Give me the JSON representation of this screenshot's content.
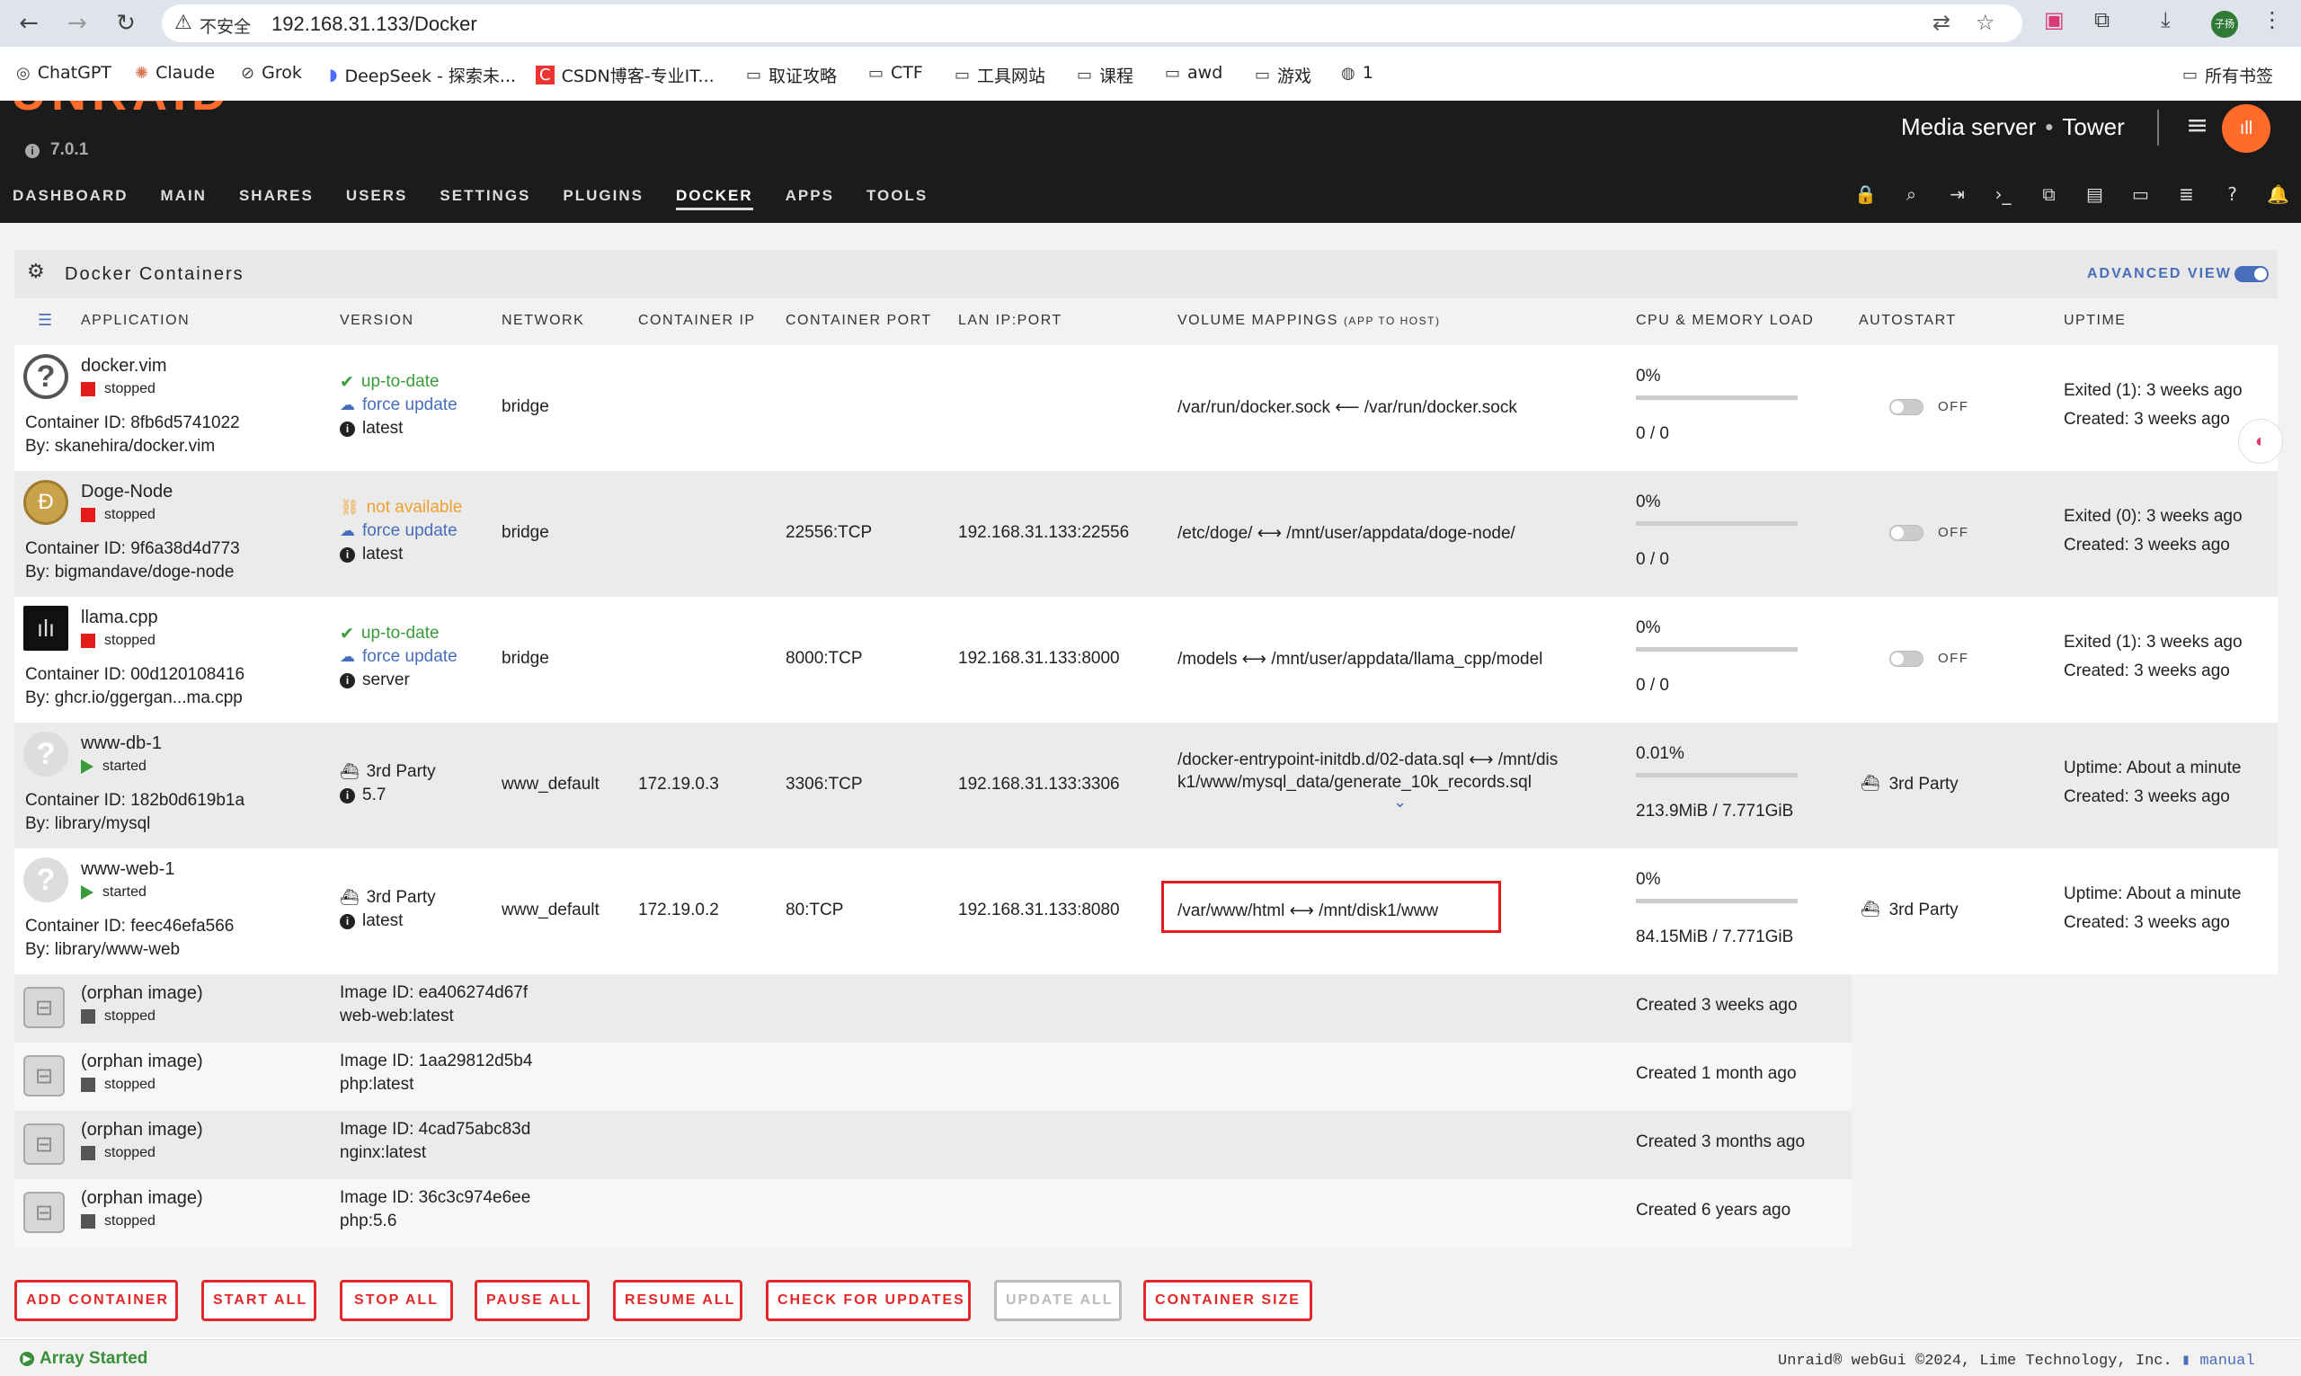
{
  "browser": {
    "insecure_label": "不安全",
    "url": "192.168.31.133/Docker",
    "bookmarks": [
      {
        "label": "ChatGPT"
      },
      {
        "label": "Claude"
      },
      {
        "label": "Grok"
      },
      {
        "label": "DeepSeek - 探索未..."
      },
      {
        "label": "CSDN博客-专业IT..."
      },
      {
        "label": "取证攻略"
      },
      {
        "label": "CTF"
      },
      {
        "label": "工具网站"
      },
      {
        "label": "课程"
      },
      {
        "label": "awd"
      },
      {
        "label": "游戏"
      },
      {
        "label": "1"
      }
    ],
    "all_bookmarks": "所有书签",
    "profile_text": "子扬"
  },
  "header": {
    "logo": "UNRAID",
    "version": "7.0.1",
    "server_desc": "Media server",
    "server_name": "Tower",
    "menu": [
      "DASHBOARD",
      "MAIN",
      "SHARES",
      "USERS",
      "SETTINGS",
      "PLUGINS",
      "DOCKER",
      "APPS",
      "TOOLS"
    ],
    "active_menu": "DOCKER"
  },
  "docker": {
    "title": "Docker Containers",
    "advanced_view_label": "ADVANCED VIEW",
    "columns": {
      "application": "APPLICATION",
      "version": "VERSION",
      "network": "NETWORK",
      "container_ip": "CONTAINER IP",
      "container_port": "CONTAINER PORT",
      "lan_ip_port": "LAN IP:PORT",
      "volume_mappings": "VOLUME MAPPINGS",
      "volume_mappings_sub": "(APP TO HOST)",
      "cpu_mem": "CPU & MEMORY LOAD",
      "autostart": "AUTOSTART",
      "uptime": "UPTIME"
    },
    "containers": [
      {
        "name": "docker.vim",
        "state": "stopped",
        "container_id": "Container ID: 8fb6d5741022",
        "by": "By: skanehira/docker.vim",
        "ver1": "up-to-date",
        "ver2": "force update",
        "ver3": "latest",
        "network": "bridge",
        "ip": "",
        "port": "",
        "lan": "",
        "volume": "/var/run/docker.sock ⟵ /var/run/docker.sock",
        "cpu": "0%",
        "cpu_fraction": 0,
        "mem": "0 / 0",
        "autostart": "OFF",
        "uptime1": "Exited (1): 3 weeks ago",
        "uptime2": "Created: 3 weeks ago"
      },
      {
        "name": "Doge-Node",
        "state": "stopped",
        "container_id": "Container ID: 9f6a38d4d773",
        "by": "By: bigmandave/doge-node",
        "ver1": "not available",
        "ver2": "force update",
        "ver3": "latest",
        "network": "bridge",
        "ip": "",
        "port": "22556:TCP",
        "lan": "192.168.31.133:22556",
        "volume": "/etc/doge/ ⟷ /mnt/user/appdata/doge-node/",
        "cpu": "0%",
        "cpu_fraction": 0,
        "mem": "0 / 0",
        "autostart": "OFF",
        "uptime1": "Exited (0): 3 weeks ago",
        "uptime2": "Created: 3 weeks ago"
      },
      {
        "name": "llama.cpp",
        "state": "stopped",
        "container_id": "Container ID: 00d120108416",
        "by": "By: ghcr.io/ggergan...ma.cpp",
        "ver1": "up-to-date",
        "ver2": "force update",
        "ver3": "server",
        "network": "bridge",
        "ip": "",
        "port": "8000:TCP",
        "lan": "192.168.31.133:8000",
        "volume": "/models ⟷ /mnt/user/appdata/llama_cpp/model",
        "cpu": "0%",
        "cpu_fraction": 0,
        "mem": "0 / 0",
        "autostart": "OFF",
        "uptime1": "Exited (1): 3 weeks ago",
        "uptime2": "Created: 3 weeks ago"
      },
      {
        "name": "www-db-1",
        "state": "started",
        "container_id": "Container ID: 182b0d619b1a",
        "by": "By: library/mysql",
        "ver1": "3rd Party",
        "ver2": "5.7",
        "network": "www_default",
        "ip": "172.19.0.3",
        "port": "3306:TCP",
        "lan": "192.168.31.133:3306",
        "volume": "/docker-entrypoint-initdb.d/02-data.sql ⟷ /mnt/dis",
        "volume2": "k1/www/mysql_data/generate_10k_records.sql",
        "cpu": "0.01%",
        "cpu_fraction": 0.01,
        "mem": "213.9MiB / 7.771GiB",
        "autostart": "3rd Party",
        "uptime1": "Uptime: About a minute",
        "uptime2": "Created: 3 weeks ago"
      },
      {
        "name": "www-web-1",
        "state": "started",
        "container_id": "Container ID: feec46efa566",
        "by": "By: library/www-web",
        "ver1": "3rd Party",
        "ver2": "latest",
        "network": "www_default",
        "ip": "172.19.0.2",
        "port": "80:TCP",
        "lan": "192.168.31.133:8080",
        "volume": "/var/www/html ⟷ /mnt/disk1/www",
        "cpu": "0%",
        "cpu_fraction": 0,
        "mem": "84.15MiB / 7.771GiB",
        "autostart": "3rd Party",
        "uptime1": "Uptime: About a minute",
        "uptime2": "Created: 3 weeks ago"
      }
    ],
    "orphans": [
      {
        "name": "(orphan image)",
        "state": "stopped",
        "image_id": "Image ID: ea406274d67f",
        "tag": "web-web:latest",
        "created": "Created 3 weeks ago"
      },
      {
        "name": "(orphan image)",
        "state": "stopped",
        "image_id": "Image ID: 1aa29812d5b4",
        "tag": "php:latest",
        "created": "Created 1 month ago"
      },
      {
        "name": "(orphan image)",
        "state": "stopped",
        "image_id": "Image ID: 4cad75abc83d",
        "tag": "nginx:latest",
        "created": "Created 3 months ago"
      },
      {
        "name": "(orphan image)",
        "state": "stopped",
        "image_id": "Image ID: 36c3c974e6ee",
        "tag": "php:5.6",
        "created": "Created 6 years ago"
      }
    ],
    "buttons": {
      "add": "ADD CONTAINER",
      "start_all": "START ALL",
      "stop_all": "STOP ALL",
      "pause_all": "PAUSE ALL",
      "resume_all": "RESUME ALL",
      "check_updates": "CHECK FOR UPDATES",
      "update_all": "UPDATE ALL",
      "container_size": "CONTAINER SIZE"
    }
  },
  "footer": {
    "status": "Array Started",
    "copyright": "Unraid® webGui ©2024, Lime Technology, Inc.",
    "manual": "manual"
  },
  "colors": {
    "accent": "#ff6b2b",
    "link": "#486dba",
    "stopped": "#e41b1b",
    "started": "#3a9b3a",
    "button_border": "#e22828"
  }
}
